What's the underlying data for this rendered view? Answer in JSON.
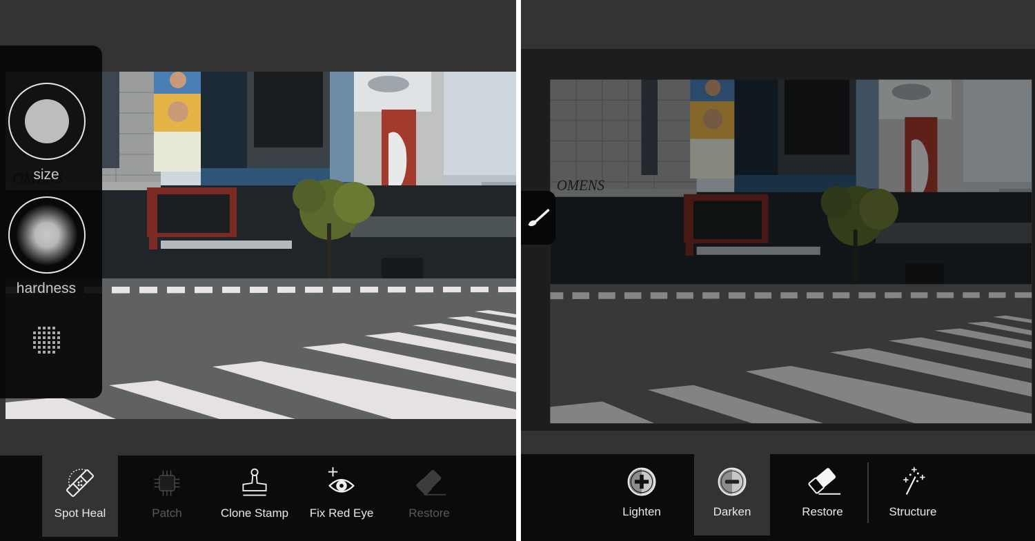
{
  "left_screen": {
    "brush_panel": {
      "size_label": "size",
      "hardness_label": "hardness",
      "icons": {
        "size": "brush-size-icon",
        "hardness": "brush-hardness-icon",
        "mask": "dot-grid-icon"
      }
    },
    "toolbar": {
      "tools": [
        {
          "label": "Spot Heal",
          "icon": "bandage-icon",
          "state": "active"
        },
        {
          "label": "Patch",
          "icon": "patch-icon",
          "state": "disabled"
        },
        {
          "label": "Clone Stamp",
          "icon": "stamp-icon",
          "state": "enabled"
        },
        {
          "label": "Fix Red Eye",
          "icon": "eye-plus-icon",
          "state": "enabled"
        },
        {
          "label": "Restore",
          "icon": "eraser-icon",
          "state": "disabled"
        }
      ]
    }
  },
  "right_screen": {
    "brush_button_icon": "paintbrush-icon",
    "toolbar": {
      "tools": [
        {
          "label": "Lighten",
          "icon": "plus-circle-icon",
          "state": "enabled"
        },
        {
          "label": "Darken",
          "icon": "minus-circle-icon",
          "state": "active"
        },
        {
          "label": "Restore",
          "icon": "eraser-icon",
          "state": "enabled"
        },
        {
          "label": "Structure",
          "icon": "magic-wand-icon",
          "state": "enabled"
        }
      ]
    }
  },
  "colors": {
    "workspace_bg": "#333333",
    "toolbar_bg": "#0b0b0b",
    "active_tool_bg": "#333333",
    "label_text": "#e8e8e8",
    "disabled_text": "#5a5a5a"
  }
}
